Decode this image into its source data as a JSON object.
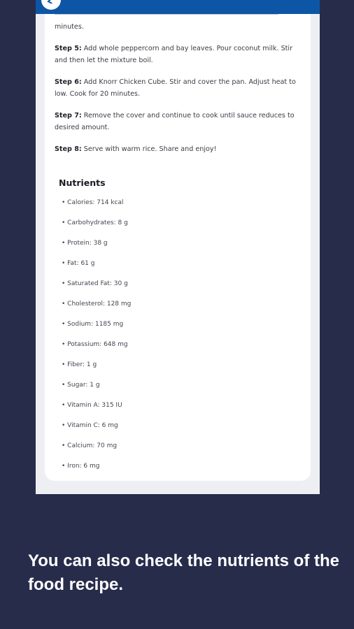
{
  "steps": {
    "continued_text": "minutes.",
    "items": [
      {
        "label": "Step 5:",
        "text": " Add whole peppercorn and bay leaves. Pour coconut milk. Stir and then let the mixture boil."
      },
      {
        "label": "Step 6:",
        "text": " Add Knorr Chicken Cube. Stir and cover the pan. Adjust heat to low. Cook for 20 minutes."
      },
      {
        "label": "Step 7:",
        "text": " Remove the cover and continue to cook until sauce reduces to desired amount."
      },
      {
        "label": "Step 8:",
        "text": " Serve with warm rice. Share and enjoy!"
      }
    ]
  },
  "nutrients": {
    "title": "Nutrients",
    "items": [
      "• Calories:  714 kcal",
      "• Carbohydrates:  8 g",
      "• Protein:  38 g",
      "• Fat:  61 g",
      "• Saturated Fat:  30 g",
      "• Cholesterol:  128 mg",
      "• Sodium:  1185 mg",
      "• Potassium:  648 mg",
      "• Fiber:  1 g",
      "• Sugar:  1 g",
      "• Vitamin A:  315 IU",
      "• Vitamin C:  6 mg",
      "• Calcium:  70 mg",
      "• Iron:  6 mg"
    ]
  },
  "caption": "You can also check the nutrients of the food recipe.",
  "colors": {
    "background": "#272c4b",
    "appbar": "#0d56a6",
    "card": "#ffffff"
  },
  "icons": {
    "back": "chevron-left-icon"
  }
}
